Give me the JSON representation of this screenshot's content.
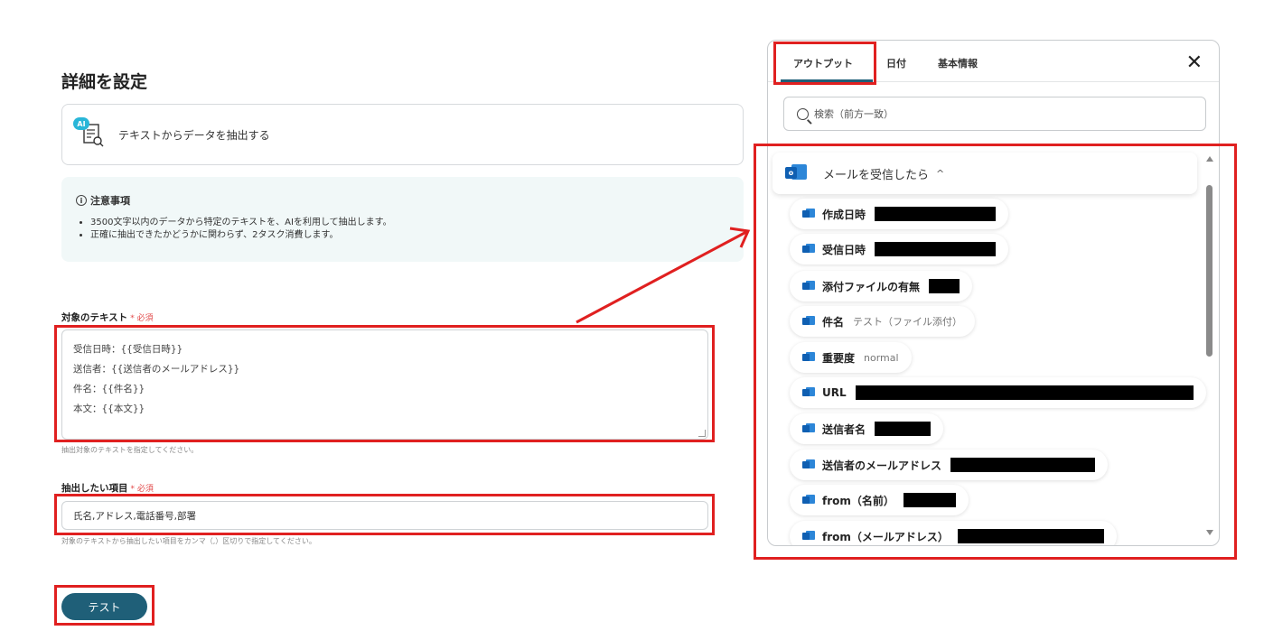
{
  "page": {
    "title": "詳細を設定",
    "action": {
      "ai_badge": "AI",
      "label": "テキストからデータを抽出する"
    },
    "notice": {
      "title": "注意事項",
      "info_symbol": "i",
      "items": [
        "3500文字以内のデータから特定のテキストを、AIを利用して抽出します。",
        "正確に抽出できたかどうかに関わらず、2タスク消費します。"
      ]
    },
    "target_text": {
      "label": "対象のテキスト",
      "required": "* 必須",
      "lines": [
        "受信日時：{{受信日時}}",
        "送信者：{{送信者のメールアドレス}}",
        "件名：{{件名}}",
        "本文：{{本文}}"
      ],
      "help": "抽出対象のテキストを指定してください。"
    },
    "extract_items": {
      "label": "抽出したい項目",
      "required": "* 必須",
      "value": "氏名,アドレス,電話番号,部署",
      "help": "対象のテキストから抽出したい項目をカンマ（,）区切りで指定してください。"
    },
    "test_button": "テスト"
  },
  "panel": {
    "tabs": [
      "アウトプット",
      "日付",
      "基本情報"
    ],
    "active_tab": "アウトプット",
    "close_symbol": "✕",
    "search_placeholder": "検索（前方一致）",
    "group": {
      "icon": "outlook-icon",
      "icon_letter": "o",
      "label": "メールを受信したら",
      "chevron": "^"
    },
    "items": [
      {
        "label": "作成日時",
        "value": ""
      },
      {
        "label": "受信日時",
        "value": ""
      },
      {
        "label": "添付ファイルの有無",
        "value": ""
      },
      {
        "label": "件名",
        "value": "テスト（ファイル添付）"
      },
      {
        "label": "重要度",
        "value": "normal"
      },
      {
        "label": "URL",
        "value": ""
      },
      {
        "label": "送信者名",
        "value": ""
      },
      {
        "label": "送信者のメールアドレス",
        "value": ""
      },
      {
        "label": "from（名前）",
        "value": ""
      },
      {
        "label": "from（メールアドレス）",
        "value": ""
      }
    ]
  },
  "colors": {
    "accent": "#1f5f78",
    "highlight": "#e02020",
    "required": "#e24a4a",
    "outlook": "#0f5fb2"
  }
}
